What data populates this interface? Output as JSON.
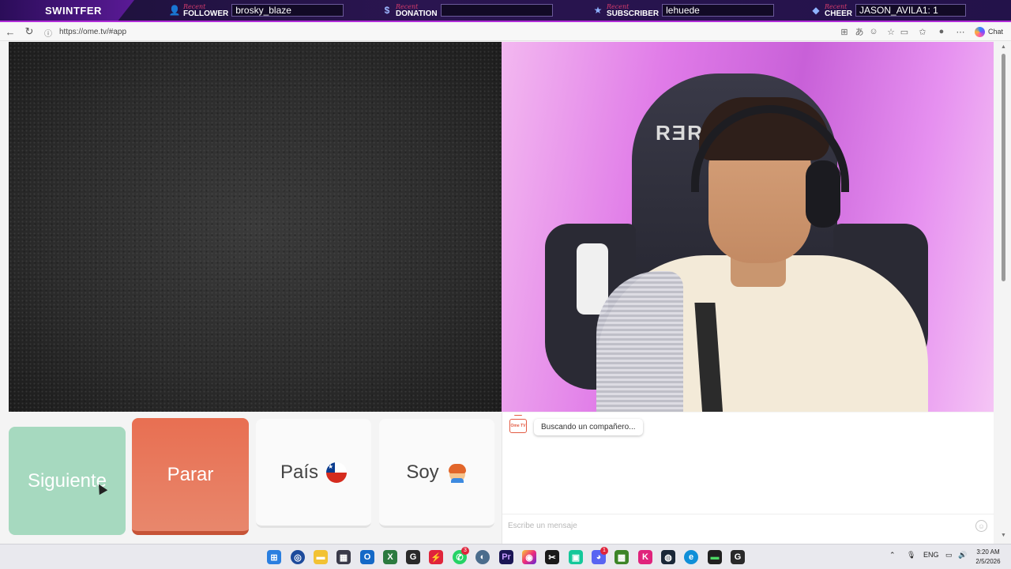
{
  "overlay": {
    "brand": "SWINTFER",
    "items": [
      {
        "recent": "Recent",
        "type": "FOLLOWER",
        "value": "brosky_blaze",
        "icon": "follower-icon"
      },
      {
        "recent": "Recent",
        "type": "DONATION",
        "value": "",
        "icon": "dollar-icon"
      },
      {
        "recent": "Recent",
        "type": "SUBSCRIBER",
        "value": "lehuede",
        "icon": "star-icon"
      },
      {
        "recent": "Recent",
        "type": "CHEER",
        "value": "JASON_AVILA1: 1",
        "icon": "bits-icon"
      }
    ]
  },
  "browser": {
    "url": "https://ome.tv/#app",
    "chat_label": "Chat"
  },
  "controls": {
    "next_label": "Siguiente",
    "stop_label": "Parar",
    "country_label": "País",
    "gender_label": "Soy"
  },
  "chat": {
    "status_message": "Buscando un compañero...",
    "input_placeholder": "Escribe un mensaje",
    "logo_text": "Ome TV"
  },
  "webcam": {
    "chair_logo": "RƎR"
  },
  "taskbar": {
    "lang": "ENG",
    "time": "3:20 AM",
    "date": "2/5/2026",
    "whatsapp_badge": "3",
    "discord_badge": "1"
  },
  "colors": {
    "next_button": "#a6d9bf",
    "stop_button": "#e86f52",
    "accent": "#b02bd8"
  }
}
